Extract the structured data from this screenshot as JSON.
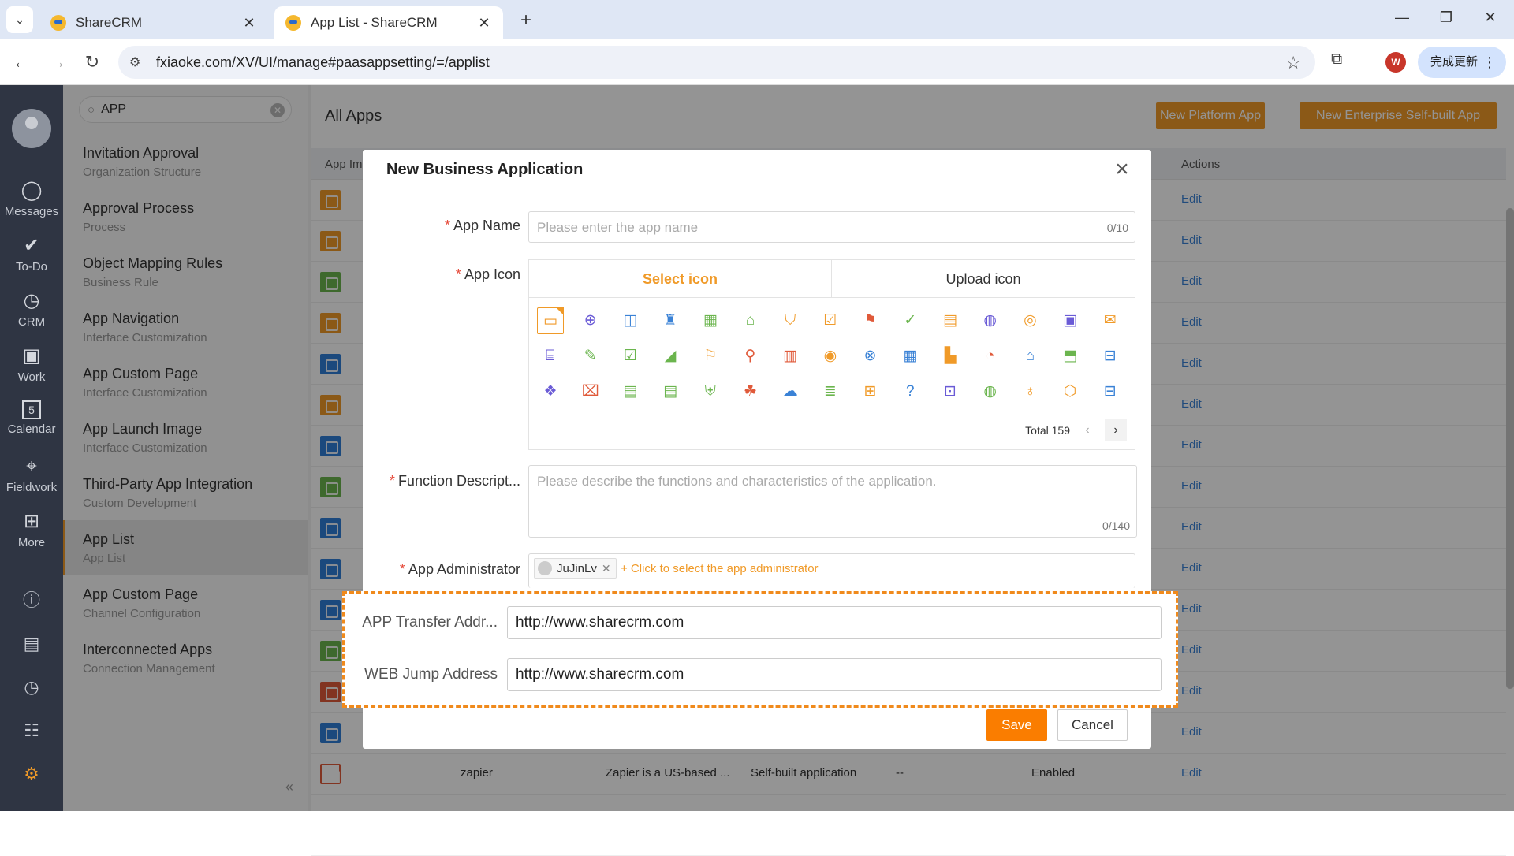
{
  "browser": {
    "tabs": [
      {
        "title": "ShareCRM"
      },
      {
        "title": "App List - ShareCRM"
      }
    ],
    "url": "fxiaoke.com/XV/UI/manage#paasappsetting/=/applist",
    "update_label": "完成更新",
    "profile_initial": "W"
  },
  "rail": {
    "items": [
      {
        "label": "Messages"
      },
      {
        "label": "To-Do"
      },
      {
        "label": "CRM"
      },
      {
        "label": "Work"
      },
      {
        "label": "Calendar",
        "badge": "5"
      },
      {
        "label": "Fieldwork"
      },
      {
        "label": "More"
      }
    ]
  },
  "sidebar": {
    "search_value": "APP",
    "items": [
      {
        "title": "Invitation Approval",
        "sub": "Organization Structure"
      },
      {
        "title": "Approval Process",
        "sub": "Process"
      },
      {
        "title": "Object Mapping Rules",
        "sub": "Business Rule"
      },
      {
        "title": "App Navigation",
        "sub": "Interface Customization"
      },
      {
        "title": "App Custom Page",
        "sub": "Interface Customization"
      },
      {
        "title": "App Launch Image",
        "sub": "Interface Customization"
      },
      {
        "title": "Third-Party App Integration",
        "sub": "Custom Development"
      },
      {
        "title": "App List",
        "sub": "App List"
      },
      {
        "title": "App Custom Page",
        "sub": "Channel Configuration"
      },
      {
        "title": "Interconnected Apps",
        "sub": "Connection Management"
      }
    ],
    "collapse_icon": "«"
  },
  "main": {
    "title": "All Apps",
    "new_platform_app": "New Platform App",
    "new_enterprise_app": "New Enterprise Self-built App",
    "col_app_image": "App Im",
    "col_actions": "Actions",
    "edit_label": "Edit",
    "row_colors": [
      "#f09a28",
      "#f09a28",
      "#6bb54e",
      "#f09a28",
      "#2f7fd8",
      "#f09a28",
      "#2f7fd8",
      "#6bb54e",
      "#2f7fd8",
      "#2f7fd8",
      "#2f7fd8",
      "#6bb54e",
      "#e05a3a",
      "#2f7fd8"
    ],
    "last_row": {
      "name": "zapier",
      "desc": "Zapier is a US-based ...",
      "type": "Self-built application",
      "dash": "--",
      "status": "Enabled"
    }
  },
  "modal": {
    "title": "New Business Application",
    "app_name_label": "App Name",
    "app_name_placeholder": "Please enter the app name",
    "app_name_count": "0/10",
    "app_icon_label": "App Icon",
    "tab_select": "Select icon",
    "tab_upload": "Upload icon",
    "total_label": "Total 159",
    "func_label": "Function Descript...",
    "func_placeholder": "Please describe the functions and characteristics of the application.",
    "func_count": "0/140",
    "admin_label": "App Administrator",
    "admin_tag": "JuJinLv",
    "admin_add": "+ Click to select the app administrator",
    "transfer_label": "APP Transfer Addr...",
    "transfer_value": "http://www.sharecrm.com",
    "web_label": "WEB Jump Address",
    "web_value": "http://www.sharecrm.com",
    "save": "Save",
    "cancel": "Cancel"
  },
  "icon_grid": {
    "glyphs": [
      "▭",
      "⊕",
      "◫",
      "♜",
      "▦",
      "⌂",
      "⛉",
      "☑",
      "⚑",
      "✓",
      "▤",
      "◍",
      "◎",
      "▣",
      "✉",
      "⌸",
      "✎",
      "☑",
      "◢",
      "⚐",
      "⚲",
      "▥",
      "◉",
      "⊗",
      "▦",
      "▙",
      "◔",
      "⌂",
      "⬒",
      "⊟",
      "❖",
      "⌧",
      "▤",
      "▤",
      "⛨",
      "☘",
      "☁",
      "≣",
      "⊞",
      "?",
      "⊡",
      "◍",
      "♁",
      "⬡",
      "⊟"
    ],
    "colors": [
      "#f09a28",
      "#6a5bd6",
      "#3a82d6",
      "#3a82d6",
      "#6bb54e",
      "#6bb54e",
      "#f09a28",
      "#f09a28",
      "#e05a3a",
      "#6bb54e",
      "#f09a28",
      "#6a5bd6",
      "#f09a28",
      "#6a5bd6",
      "#f09a28",
      "#6a5bd6",
      "#6bb54e",
      "#6bb54e",
      "#6bb54e",
      "#f09a28",
      "#e05a3a",
      "#e05a3a",
      "#f09a28",
      "#3a82d6",
      "#3a82d6",
      "#f09a28",
      "#e05a3a",
      "#3a82d6",
      "#6bb54e",
      "#3a82d6",
      "#6a5bd6",
      "#e05a3a",
      "#6bb54e",
      "#6bb54e",
      "#6bb54e",
      "#e05a3a",
      "#3a82d6",
      "#6bb54e",
      "#f09a28",
      "#3a82d6",
      "#6a5bd6",
      "#6bb54e",
      "#f09a28",
      "#f09a28",
      "#3a82d6"
    ]
  }
}
